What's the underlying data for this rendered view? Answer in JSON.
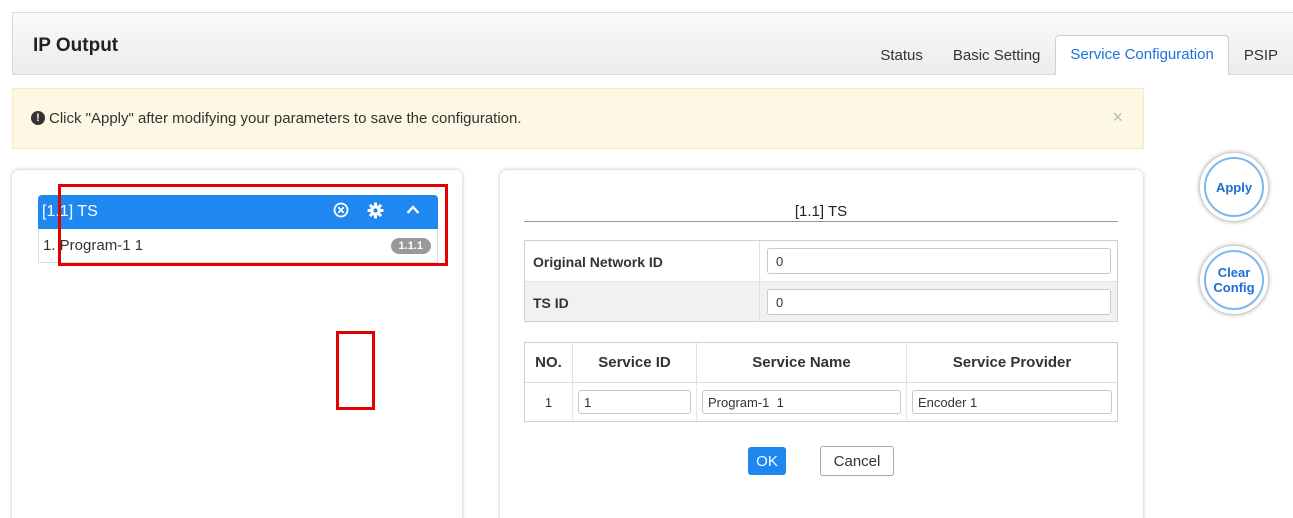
{
  "header": {
    "title": "IP Output",
    "tabs": [
      {
        "label": "Status"
      },
      {
        "label": "Basic Setting"
      },
      {
        "label": "Service Configuration"
      },
      {
        "label": "PSIP"
      }
    ],
    "active_tab": "Service Configuration"
  },
  "alert": {
    "icon": "info-circle-icon",
    "text": "Click \"Apply\" after modifying your parameters to save the configuration.",
    "close_glyph": "×"
  },
  "tree": {
    "ts_label": "[1.1] TS",
    "icons": [
      "remove-circle-icon",
      "gear-icon",
      "chevron-up-icon"
    ],
    "program": {
      "label": "1. Program-1 1",
      "badge": "1.1.1"
    }
  },
  "editor": {
    "title": "[1.1] TS",
    "fields": [
      {
        "label": "Original Network ID",
        "value": "0"
      },
      {
        "label": "TS ID",
        "value": "0"
      }
    ],
    "service_table": {
      "headers": [
        "NO.",
        "Service ID",
        "Service Name",
        "Service Provider"
      ],
      "rows": [
        {
          "no": "1",
          "service_id": "1",
          "service_name": "Program-1  1",
          "service_provider": "Encoder 1"
        }
      ]
    },
    "ok_label": "OK",
    "cancel_label": "Cancel"
  },
  "actions": {
    "apply_label": "Apply",
    "clear_label_line1": "Clear",
    "clear_label_line2": "Config"
  },
  "colors": {
    "accent": "#1e88f0",
    "alert_bg": "#fcf8e3",
    "highlight": "#e00000"
  }
}
